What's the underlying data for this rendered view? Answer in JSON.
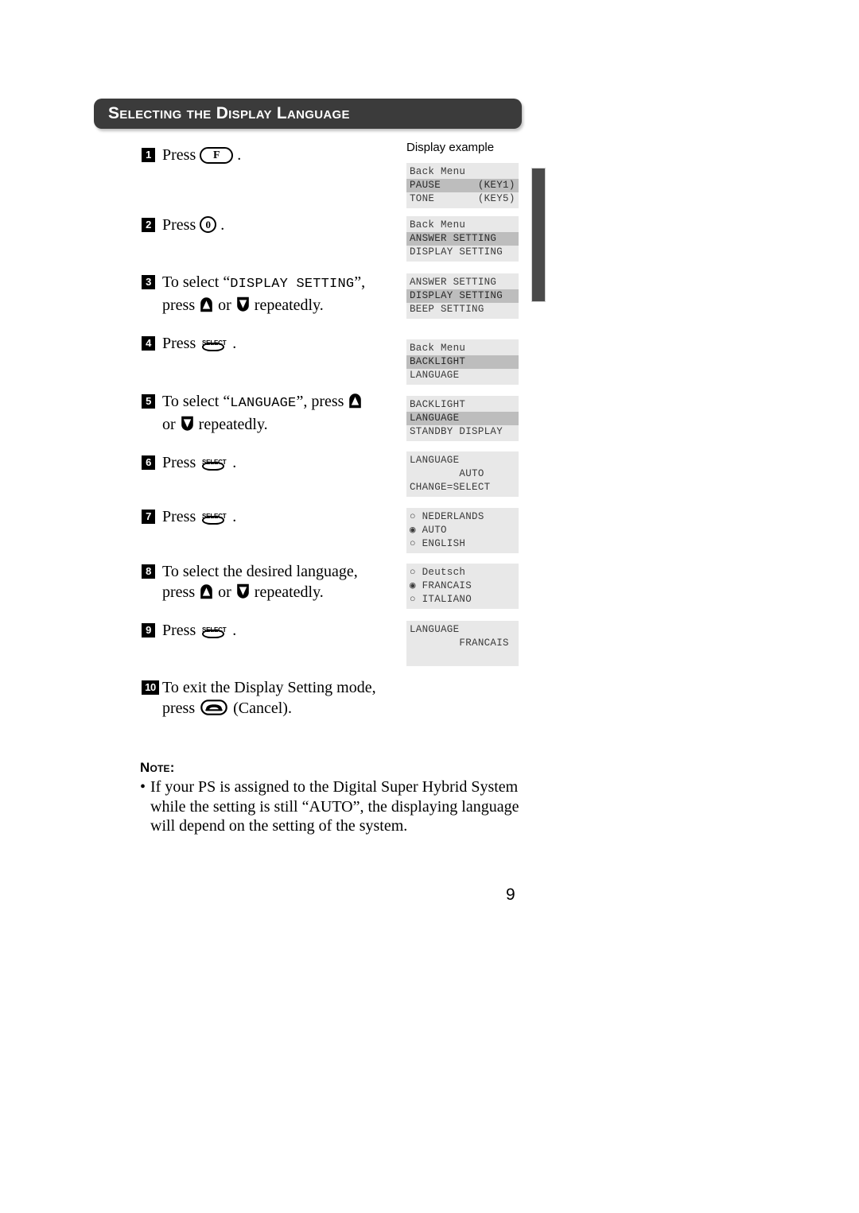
{
  "header": {
    "title": "Selecting the Display Language"
  },
  "display_column": {
    "caption": "Display example"
  },
  "steps": [
    {
      "num": "1",
      "text_before": "Press",
      "key": "F",
      "key_type": "pill",
      "text_after": "."
    },
    {
      "num": "2",
      "text_before": "Press",
      "key": "0",
      "key_type": "circle",
      "text_after": "."
    },
    {
      "num": "3",
      "line1_before": "To select “",
      "line1_mono": "DISPLAY SETTING",
      "line1_after": "”,",
      "line2_before": "press",
      "line2_mid": "or",
      "line2_after": "repeatedly."
    },
    {
      "num": "4",
      "text_before": "Press",
      "key": "SELECT",
      "key_type": "select",
      "text_after": "."
    },
    {
      "num": "5",
      "line1_before": "To select “",
      "line1_mono": "LANGUAGE",
      "line1_after": "”, press",
      "line2_before": "or",
      "line2_after": "repeatedly."
    },
    {
      "num": "6",
      "text_before": "Press",
      "key": "SELECT",
      "key_type": "select",
      "text_after": "."
    },
    {
      "num": "7",
      "text_before": "Press",
      "key": "SELECT",
      "key_type": "select",
      "text_after": "."
    },
    {
      "num": "8",
      "line1": "To select the desired language,",
      "line2_before": "press",
      "line2_mid": "or",
      "line2_after": "repeatedly."
    },
    {
      "num": "9",
      "text_before": "Press",
      "key": "SELECT",
      "key_type": "select",
      "text_after": "."
    },
    {
      "num": "10",
      "line1": "To exit the Display Setting mode,",
      "line2_before": "press",
      "line2_after": "(Cancel)."
    }
  ],
  "lcd_panels": [
    {
      "id": "panel-1",
      "lines": [
        {
          "text": "Back Menu",
          "highlight": false
        },
        {
          "text": "PAUSE      (KEY1)",
          "highlight": true
        },
        {
          "text": "TONE       (KEY5)",
          "highlight": false
        }
      ]
    },
    {
      "id": "panel-2",
      "lines": [
        {
          "text": "Back Menu",
          "highlight": false
        },
        {
          "text": "ANSWER SETTING",
          "highlight": true
        },
        {
          "text": "DISPLAY SETTING",
          "highlight": false
        }
      ]
    },
    {
      "id": "panel-3",
      "lines": [
        {
          "text": "ANSWER SETTING",
          "highlight": false
        },
        {
          "text": "DISPLAY SETTING",
          "highlight": true
        },
        {
          "text": "BEEP SETTING",
          "highlight": false
        }
      ]
    },
    {
      "id": "panel-4",
      "lines": [
        {
          "text": "Back Menu",
          "highlight": false
        },
        {
          "text": "BACKLIGHT",
          "highlight": true
        },
        {
          "text": "LANGUAGE",
          "highlight": false
        }
      ]
    },
    {
      "id": "panel-5",
      "lines": [
        {
          "text": "BACKLIGHT",
          "highlight": false
        },
        {
          "text": "LANGUAGE",
          "highlight": true
        },
        {
          "text": "STANDBY DISPLAY",
          "highlight": false
        }
      ]
    },
    {
      "id": "panel-6",
      "lines": [
        {
          "text": "LANGUAGE",
          "highlight": false
        },
        {
          "text": "        AUTO",
          "highlight": false
        },
        {
          "text": "CHANGE=SELECT",
          "highlight": false
        }
      ]
    },
    {
      "id": "panel-7",
      "lines": [
        {
          "text": "○ NEDERLANDS",
          "highlight": false
        },
        {
          "text": "◉ AUTO",
          "highlight": false
        },
        {
          "text": "○ ENGLISH",
          "highlight": false
        }
      ]
    },
    {
      "id": "panel-8",
      "lines": [
        {
          "text": "○ Deutsch",
          "highlight": false
        },
        {
          "text": "◉ FRANCAIS",
          "highlight": false
        },
        {
          "text": "○ ITALIANO",
          "highlight": false
        }
      ]
    },
    {
      "id": "panel-9",
      "lines": [
        {
          "text": "LANGUAGE",
          "highlight": false
        },
        {
          "text": "        FRANCAIS",
          "highlight": false
        },
        {
          "text": " ",
          "highlight": false
        }
      ]
    }
  ],
  "note": {
    "title": "Note:",
    "bullet": "•",
    "body": "If your PS is assigned to the Digital Super Hybrid System while the setting is still “AUTO”, the displaying language will depend on the setting of the system."
  },
  "page": {
    "number": "9"
  }
}
